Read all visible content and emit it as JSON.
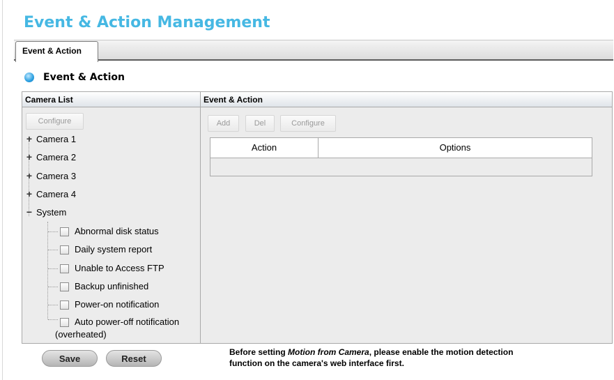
{
  "page": {
    "title": "Event & Action Management"
  },
  "tab": {
    "label": "Event & Action"
  },
  "section": {
    "title": "Event & Action"
  },
  "camera_list": {
    "header": "Camera List",
    "configure_label": "Configure",
    "cameras": [
      {
        "label": "Camera 1",
        "expander": "+"
      },
      {
        "label": "Camera 2",
        "expander": "+"
      },
      {
        "label": "Camera 3",
        "expander": "+"
      },
      {
        "label": "Camera 4",
        "expander": "+"
      }
    ],
    "system": {
      "label": "System",
      "expander": "−",
      "items": [
        {
          "label": "Abnormal disk status",
          "checked": false
        },
        {
          "label": "Daily system report",
          "checked": false
        },
        {
          "label": "Unable to Access FTP",
          "checked": false
        },
        {
          "label": "Backup unfinished",
          "checked": false
        },
        {
          "label": "Power-on notification",
          "checked": false
        },
        {
          "label": "Auto power-off notification",
          "label_line2": "(overheated)",
          "checked": false
        }
      ]
    }
  },
  "event_action": {
    "header": "Event & Action",
    "buttons": {
      "add": "Add",
      "del": "Del",
      "configure": "Configure"
    },
    "table": {
      "columns": [
        "Action",
        "Options"
      ],
      "rows": []
    }
  },
  "footer": {
    "save_label": "Save",
    "reset_label": "Reset",
    "note_prefix": "Before setting ",
    "note_emphasis": "Motion from Camera",
    "note_line1_suffix": ", please enable the motion detection",
    "note_line2": "function on the camera's web interface first."
  },
  "colors": {
    "title": "#46b8e3",
    "panel_bg": "#ececec",
    "indicator": "#2a9fe0"
  }
}
